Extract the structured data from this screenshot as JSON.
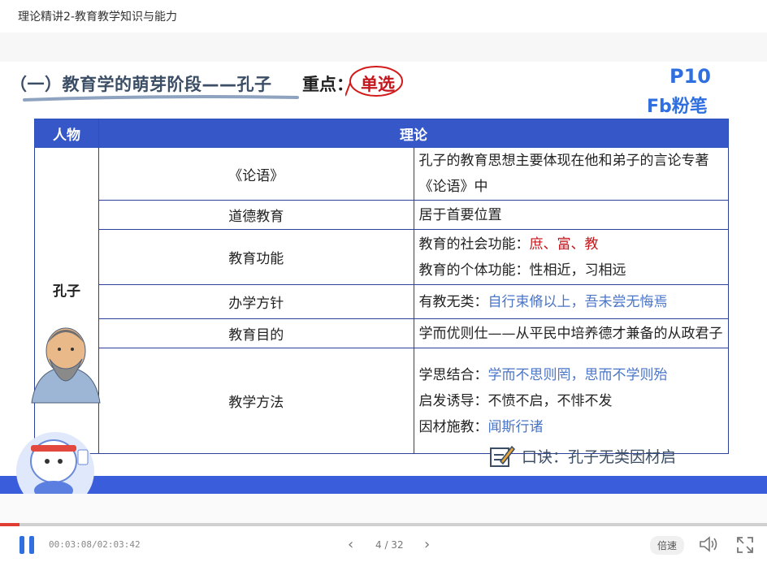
{
  "window": {
    "title": "理论精讲2-教育教学知识与能力"
  },
  "slide": {
    "heading": "（一）教育学的萌芽阶段",
    "heading_dash": "——",
    "heading_person": "孔子",
    "key_label": "重点：",
    "key_value": "单选",
    "page_label": "P10",
    "logo_text": "Fb粉笔",
    "table": {
      "headers": [
        "人物",
        "理论"
      ],
      "person": "孔子",
      "rows": [
        {
          "topic": "《论语》",
          "lines": [
            [
              {
                "t": "孔子的教育思想主要体现在他和弟子的言论专著《论语》中"
              }
            ]
          ]
        },
        {
          "topic": "道德教育",
          "lines": [
            [
              {
                "t": "居于首要位置"
              }
            ]
          ]
        },
        {
          "topic": "教育功能",
          "lines": [
            [
              {
                "t": "教育的社会功能："
              },
              {
                "t": "庶、富、教",
                "c": "red"
              }
            ],
            [
              {
                "t": "教育的个体功能：性相近，习相远"
              }
            ]
          ]
        },
        {
          "topic": "办学方针",
          "topic_color": "red",
          "lines": [
            [
              {
                "t": "有教无类："
              },
              {
                "t": "自行束脩以上，吾未尝无悔焉",
                "c": "blue"
              }
            ]
          ]
        },
        {
          "topic": "教育目的",
          "lines": [
            [
              {
                "t": "学而优则仕——从平民中培养德才兼备的从政君子"
              }
            ]
          ]
        },
        {
          "topic": "教学方法",
          "topic_color": "red",
          "lines": [
            [
              {
                "t": "学思结合："
              },
              {
                "t": "学而不思则罔，思而不学则殆",
                "c": "blue"
              }
            ],
            [
              {
                "t": "启发诱导：不愤不启，不悱不发"
              }
            ],
            [
              {
                "t": "因材施教："
              },
              {
                "t": "闻斯行诸",
                "c": "blue"
              }
            ]
          ]
        }
      ]
    },
    "formula": "口诀：孔子无类因材启"
  },
  "player": {
    "time": "00:03:08/02:03:42",
    "page": "4 / 32",
    "speed_label": "倍速",
    "progress": 0.025
  },
  "colors": {
    "accent": "#3557c8",
    "red": "#c4161c",
    "blue": "#4a76c8"
  }
}
